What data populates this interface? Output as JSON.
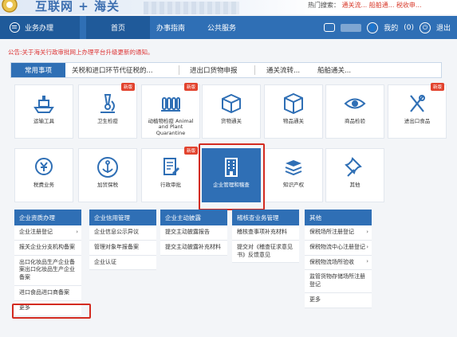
{
  "banner": {
    "site_name": "互联网 + 海关",
    "hot_label": "热门搜索：",
    "hot_links": [
      "通关流...",
      "船舶通...",
      "税收申..."
    ]
  },
  "nav": {
    "menu_label": "业务办理",
    "tabs": [
      "首页",
      "办事指南",
      "公共服务"
    ],
    "right": {
      "mine_label": "我的",
      "count": "(0)",
      "exit_label": "退出"
    }
  },
  "notice": "公告:关于海关行政审批网上办理平台升级更新的通知。",
  "common": {
    "title": "常用事项",
    "items": [
      "关税和进口环节代征税的...",
      "进出口货物申报",
      "通关流转...",
      "船舶通关..."
    ]
  },
  "tiles": [
    {
      "label": "运输工具",
      "icon": "ship-icon",
      "badge": ""
    },
    {
      "label": "卫生检疫",
      "icon": "microscope-icon",
      "badge": "新版"
    },
    {
      "label": "动植物检疫 Animal and Plant Quarantine",
      "icon": "plant-quarantine-icon",
      "badge": "新版"
    },
    {
      "label": "货物通关",
      "icon": "cargo-box-icon",
      "badge": ""
    },
    {
      "label": "物品通关",
      "icon": "package-cube-icon",
      "badge": ""
    },
    {
      "label": "商品检验",
      "icon": "inspection-eye-icon",
      "badge": ""
    },
    {
      "label": "进出口食品",
      "icon": "food-utensils-icon",
      "badge": "新版"
    },
    {
      "label": "税费业务",
      "icon": "yuan-coin-icon",
      "badge": ""
    },
    {
      "label": "加贸保税",
      "icon": "anchor-icon",
      "badge": ""
    },
    {
      "label": "行政审批",
      "icon": "approval-document-icon",
      "badge": "新版"
    },
    {
      "label": "企业管理和稽查",
      "icon": "enterprise-building-icon",
      "badge": ""
    },
    {
      "label": "知识产权",
      "icon": "stack-books-icon",
      "badge": ""
    },
    {
      "label": "其他",
      "icon": "pin-icon",
      "badge": ""
    }
  ],
  "panels": [
    {
      "title": "企业资质办理",
      "items": [
        "企业注册登记",
        "报关企业分支机构备案",
        "出口化妆品生产企业备案出口化妆品生产企业备案",
        "进口食品进口商备案",
        "更多"
      ]
    },
    {
      "title": "企业信用管理",
      "items": [
        "企业信息公示异议",
        "管理对象年报备案",
        "企业认证"
      ]
    },
    {
      "title": "企业主动披露",
      "items": [
        "提交主动披露报告",
        "提交主动披露补充材料"
      ]
    },
    {
      "title": "稽核查业务管理",
      "items": [
        "稽核查事项补充材料",
        "提交对《稽查征求意见书》反馈意见"
      ]
    },
    {
      "title": "其他",
      "items": [
        "保税场所注册登记",
        "保税物流中心注册登记",
        "保税物流场所验收",
        "监管货物存储场所注册登记",
        "更多"
      ]
    }
  ],
  "colors": {
    "primary": "#2f6fb5",
    "primary_dark": "#1f5a9a",
    "badge": "#e2432e",
    "highlight_box": "#d32b20"
  }
}
